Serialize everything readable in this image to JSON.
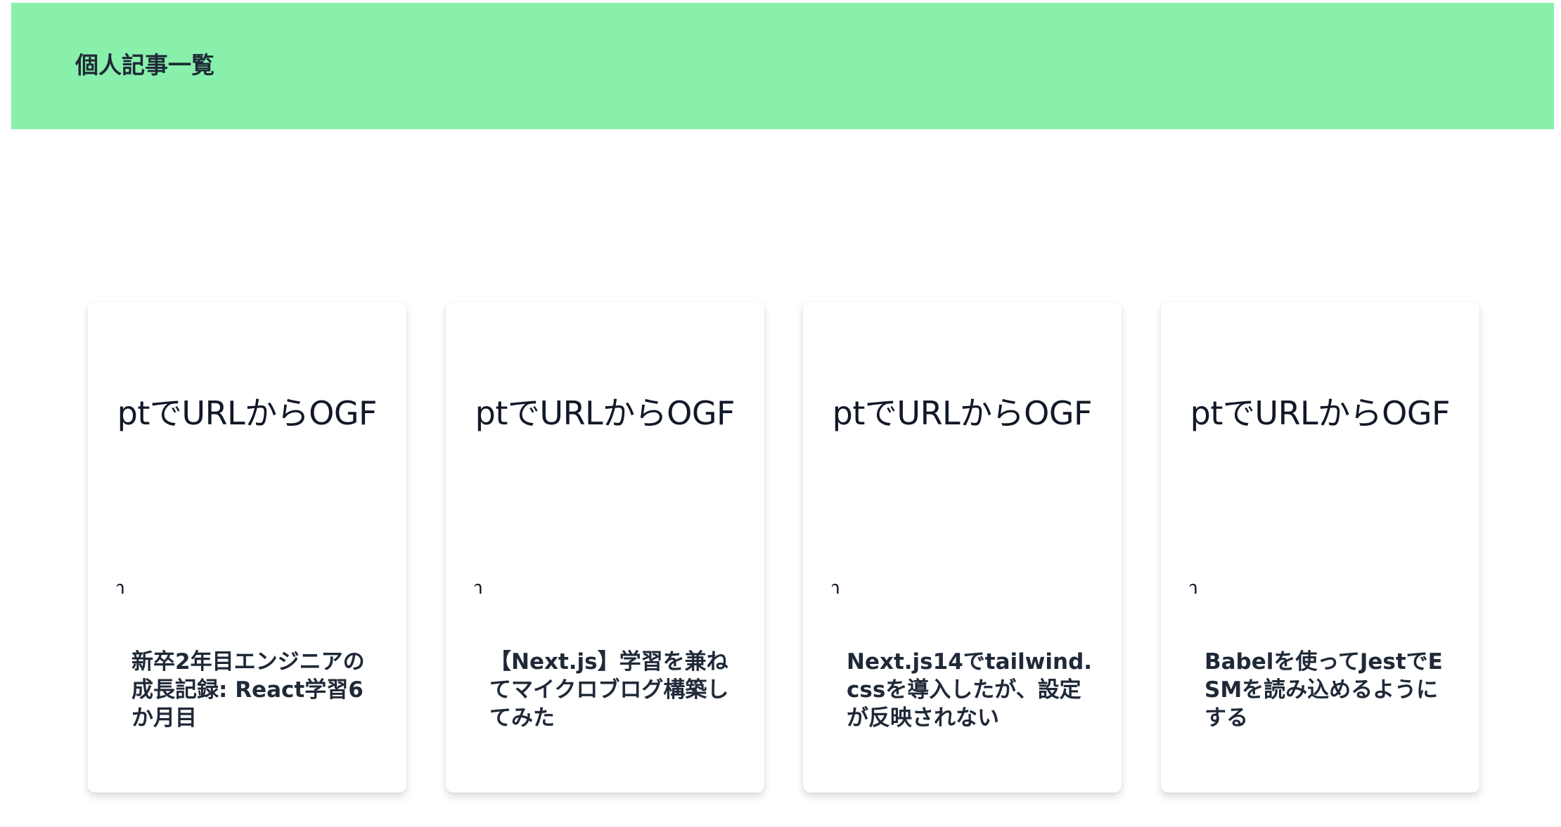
{
  "header": {
    "title": "個人記事一覧",
    "background_color": "#88f0ab"
  },
  "cards": [
    {
      "thumbnail_text": "criptでURLからOGF",
      "thumbnail_sub": "ın",
      "title": "新卒2年目エンジニアの成長記録: React学習6か月目"
    },
    {
      "thumbnail_text": "criptでURLからOGF",
      "thumbnail_sub": "ın",
      "title": "【Next.js】学習を兼ねてマイクロブログ構築してみた"
    },
    {
      "thumbnail_text": "criptでURLからOGF",
      "thumbnail_sub": "ın",
      "title": "Next.js14でtailwind.cssを導入したが、設定が反映されない"
    },
    {
      "thumbnail_text": "criptでURLからOGF",
      "thumbnail_sub": "ın",
      "title": "Babelを使ってJestでESMを読み込めるようにする"
    }
  ]
}
